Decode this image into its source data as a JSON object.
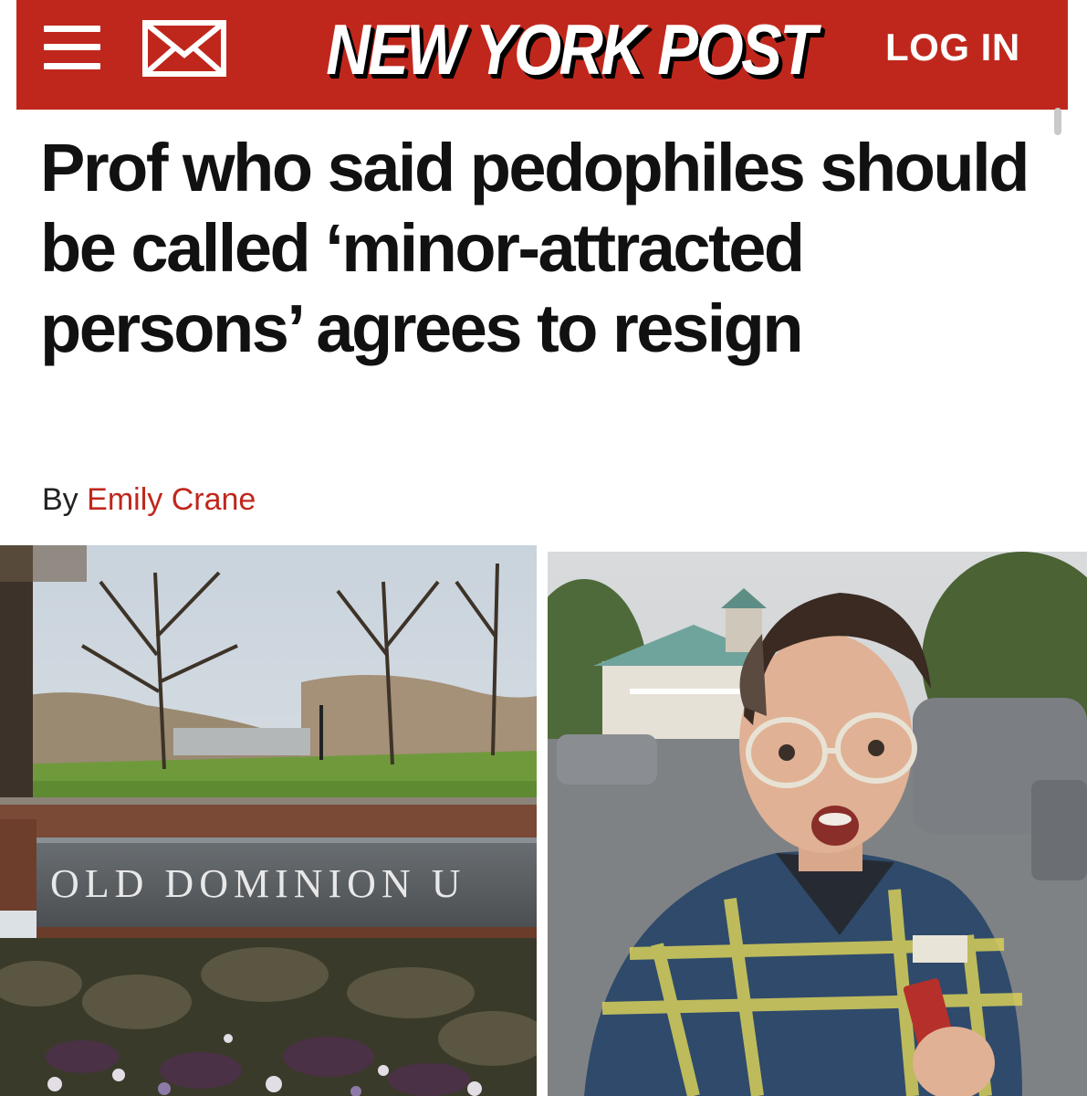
{
  "header": {
    "brand_color": "#c0271c",
    "menu_icon": "hamburger-menu-icon",
    "mail_icon": "envelope-icon",
    "logo_text": "NEW YORK POST",
    "login_label": "LOG IN"
  },
  "article": {
    "headline": "Prof who said pedophiles should be called ‘minor-attracted persons’ agrees to resign",
    "byline_prefix": "By",
    "author": "Emily Crane"
  },
  "photos": {
    "left_sign_text": "OLD DOMINION U"
  }
}
